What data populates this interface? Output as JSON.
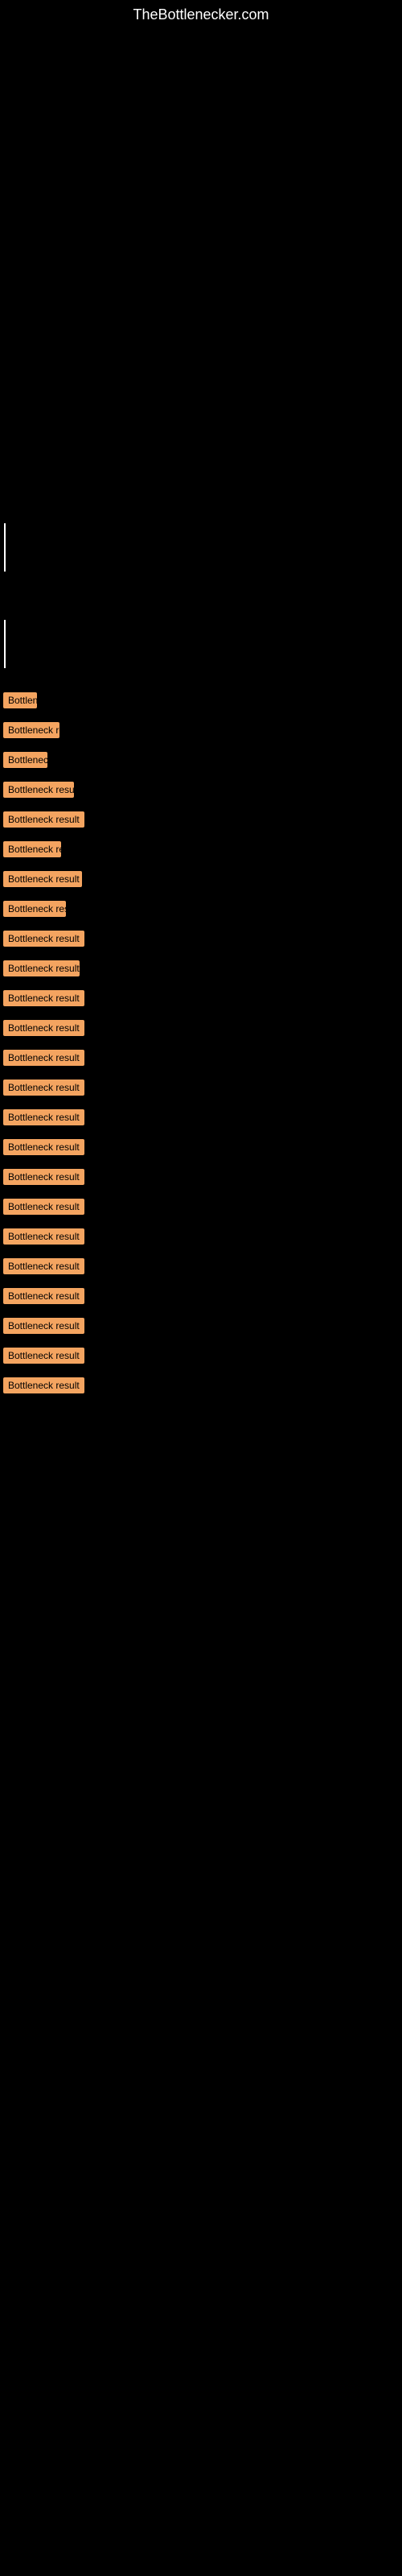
{
  "site": {
    "title": "TheBottlenecker.com"
  },
  "results": {
    "items": [
      {
        "label": "Bottleneck result"
      },
      {
        "label": "Bottleneck result"
      },
      {
        "label": "Bottleneck result"
      },
      {
        "label": "Bottleneck result"
      },
      {
        "label": "Bottleneck result"
      },
      {
        "label": "Bottleneck result"
      },
      {
        "label": "Bottleneck result"
      },
      {
        "label": "Bottleneck result"
      },
      {
        "label": "Bottleneck result"
      },
      {
        "label": "Bottleneck result"
      },
      {
        "label": "Bottleneck result"
      },
      {
        "label": "Bottleneck result"
      },
      {
        "label": "Bottleneck result"
      },
      {
        "label": "Bottleneck result"
      },
      {
        "label": "Bottleneck result"
      },
      {
        "label": "Bottleneck result"
      },
      {
        "label": "Bottleneck result"
      },
      {
        "label": "Bottleneck result"
      },
      {
        "label": "Bottleneck result"
      },
      {
        "label": "Bottleneck result"
      },
      {
        "label": "Bottleneck result"
      },
      {
        "label": "Bottleneck result"
      },
      {
        "label": "Bottleneck result"
      },
      {
        "label": "Bottleneck result"
      }
    ]
  }
}
